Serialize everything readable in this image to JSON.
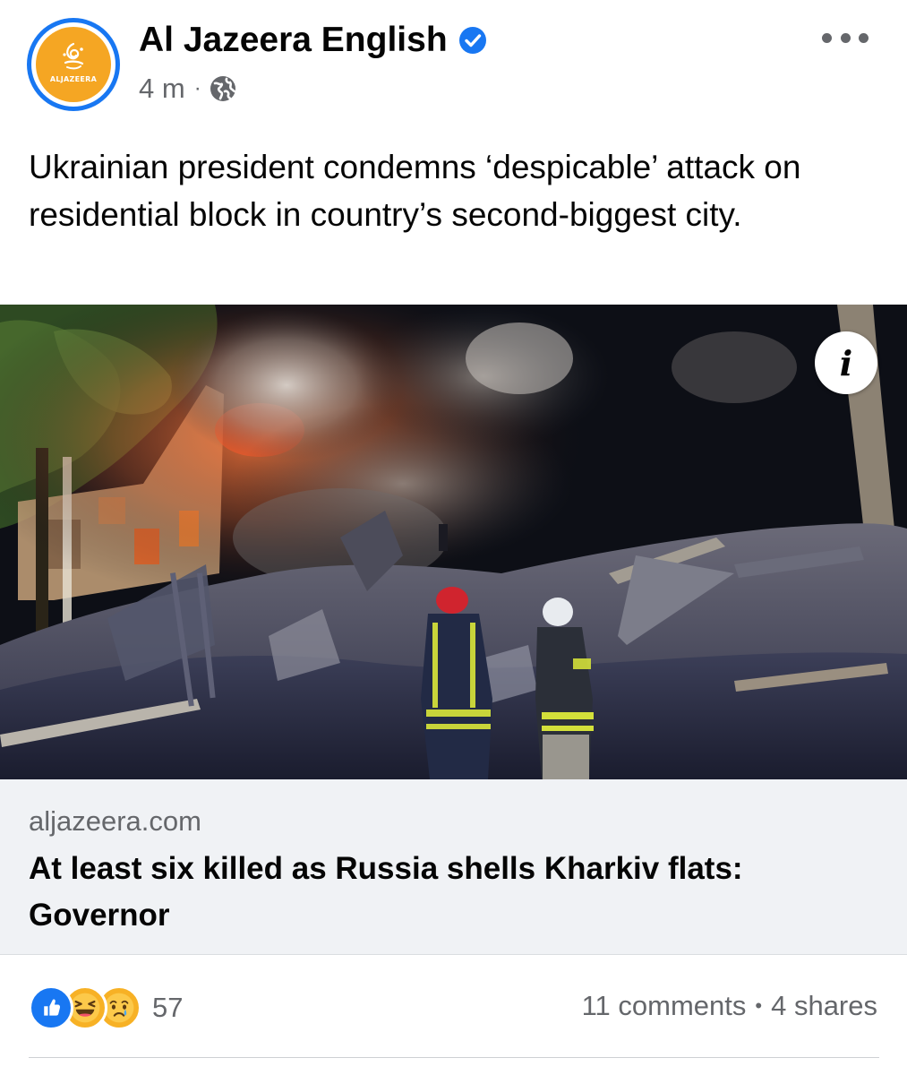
{
  "post": {
    "page_name": "Al Jazeera English",
    "avatar_brand_text": "ALJAZEERA",
    "time": "4 m",
    "meta_separator": "·",
    "caption": "Ukrainian president condemns ‘despicable’ attack on residential block in country’s second-biggest city."
  },
  "image": {
    "info_label": "i"
  },
  "link_preview": {
    "domain": "aljazeera.com",
    "title": "At least six killed as Russia shells Kharkiv flats: Governor"
  },
  "stats": {
    "reaction_icons": [
      "like-icon",
      "haha-icon",
      "sad-icon"
    ],
    "reaction_count": "57",
    "comments": "11 comments",
    "separator": "•",
    "shares": "4 shares"
  },
  "colors": {
    "verified_blue": "#1877f2",
    "avatar_orange": "#f5a623",
    "meta_gray": "#65676b",
    "preview_bg": "#f0f2f5"
  }
}
